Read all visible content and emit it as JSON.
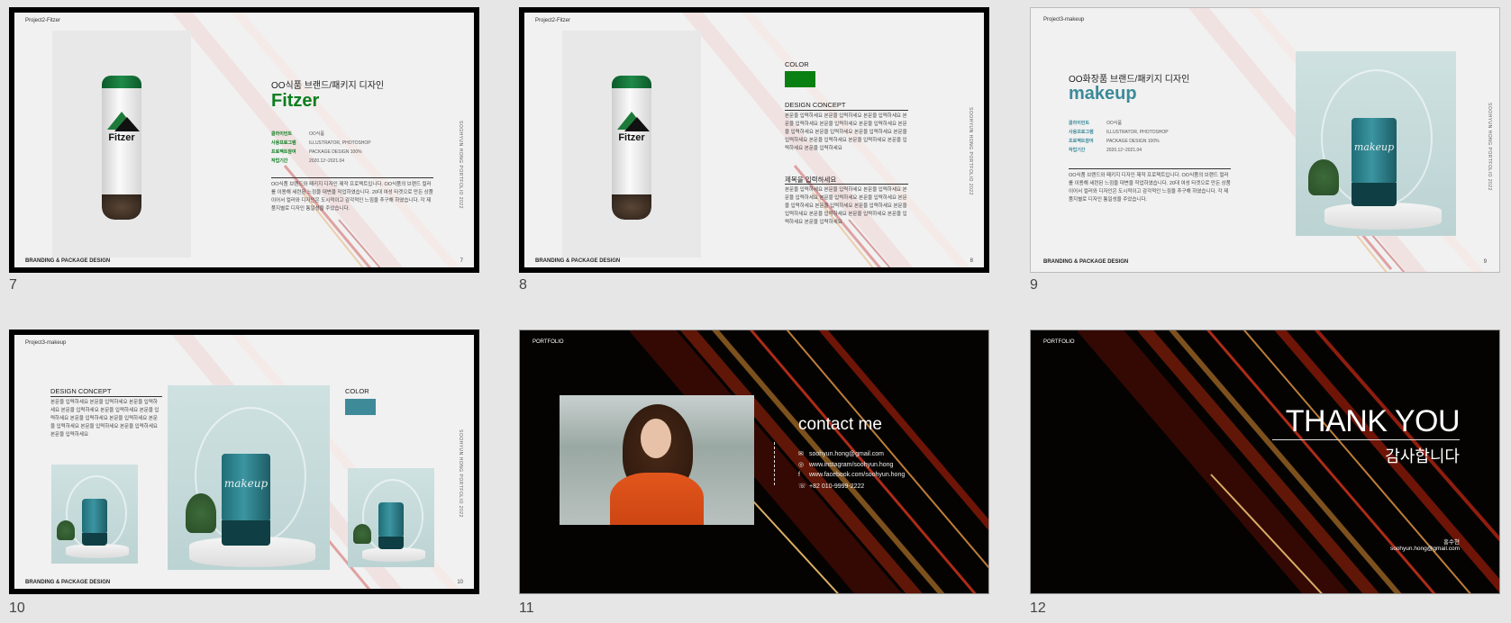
{
  "slides": [
    {
      "number": "7",
      "project_tag": "Project2-Fitzer",
      "footer_left": "BRANDING & PACKAGE DESIGN",
      "footer_right": "7",
      "vertical_text": "SOOHYUN HONG PORTFOLIO 2022",
      "kr_title": "OO식품 브랜드/패키지 디자인",
      "title": "Fitzer",
      "can_brand": "Fitzer",
      "info": [
        {
          "label": "클라이언트",
          "value": "OO식품"
        },
        {
          "label": "사용프로그램",
          "value": "ILLUSTRATOR, PHOTOSHOP"
        },
        {
          "label": "프로젝트참여",
          "value": "PACKAGE DESIGN 100%"
        },
        {
          "label": "작업기간",
          "value": "2020.12~2021.04"
        }
      ],
      "paragraph": "OO식품 브랜드와 패키지 디자인 제작 프로젝트입니다. OO식품의 브랜드 컬러를 이용해 세련된 느낌을 대변을 작업하였습니다. 20대 여성 타겟으로 만든 상품이어서 컬러와 디자인은 도시적이고 감각적인 느낌을 추구해 하였습니다. 각 제품지별로 디자인 통일성을 주었습니다."
    },
    {
      "number": "8",
      "project_tag": "Project2-Fitzer",
      "footer_left": "BRANDING & PACKAGE DESIGN",
      "footer_right": "8",
      "vertical_text": "SOOHYUN HONG PORTFOLIO 2022",
      "can_brand": "Fitzer",
      "color_label": "COLOR",
      "design_concept_label": "DESIGN CONCEPT",
      "design_concept_text": "본문을 입력하세요 본문을 입력하세요 본문을 입력하세요 본문을 입력하세요 본문을 입력하세요 본문을 입력하세요 본문을 입력하세요 본문을 입력하세요 본문을 입력하세요 본문을 입력하세요 본문을 입력하세요 본문을 입력하세요 본문을 입력하세요 본문을 입력하세요",
      "section2_title": "제목을 입력하세요",
      "section2_text": "본문을 입력하세요 본문을 입력하세요 본문을 입력하세요 본문을 입력하세요 본문을 입력하세요 본문을 입력하세요 본문을 입력하세요 본문을 입력하세요 본문을 입력하세요 본문을 입력하세요 본문을 입력하세요 본문을 입력하세요 본문을 입력하세요 본문을 입력하세요"
    },
    {
      "number": "9",
      "project_tag": "Project3-makeup",
      "footer_left": "BRANDING & PACKAGE DESIGN",
      "footer_right": "9",
      "vertical_text": "SOOHYUN HONG PORTFOLIO 2022",
      "kr_title": "OO화장품 브랜드/패키지 디자인",
      "title": "makeup",
      "info": [
        {
          "label": "클라이언트",
          "value": "OO식품"
        },
        {
          "label": "사용프로그램",
          "value": "ILLUSTRATOR, PHOTOSHOP"
        },
        {
          "label": "프로젝트참여",
          "value": "PACKAGE DESIGN 100%"
        },
        {
          "label": "작업기간",
          "value": "2020.12~2021.04"
        }
      ],
      "paragraph": "OO식품 브랜드와 패키지 디자인 제작 프로젝트입니다. OO식품의 브랜드 컬러를 이용해 세련된 느낌을 대변을 작업하였습니다. 20대 여성 타겟으로 만든 상품이어서 컬러와 디자인은 도시적이고 감각적인 느낌을 추구해 하였습니다. 각 제품지별로 디자인 통일성을 주었습니다.",
      "product_script": "makeup"
    },
    {
      "number": "10",
      "project_tag": "Project3-makeup",
      "footer_left": "BRANDING & PACKAGE DESIGN",
      "footer_right": "10",
      "vertical_text": "SOOHYUN HONG PORTFOLIO 2022",
      "design_concept_label": "DESIGN CONCEPT",
      "design_concept_text": "본문을 입력하세요 본문을 입력하세요 본문을 입력하세요 본문을 입력하세요 본문을 입력하세요 본문을 입력하세요 본문을 입력하세요 본문을 입력하세요 본문을 입력하세요 본문을 입력하세요 본문을 입력하세요 본문을 입력하세요",
      "color_label": "COLOR",
      "product_script": "makeup"
    },
    {
      "number": "11",
      "portfolio_tag": "PORTFOLIO",
      "heading": "contact me",
      "contacts": [
        {
          "icon": "email-icon",
          "glyph": "✉",
          "text": "soohyun.hong@gmail.com"
        },
        {
          "icon": "instagram-icon",
          "glyph": "◎",
          "text": "www.instagram/soohyun.hong"
        },
        {
          "icon": "facebook-icon",
          "glyph": "f",
          "text": "www.facebook.com/soohyun.hong"
        },
        {
          "icon": "phone-icon",
          "glyph": "☏",
          "text": "+82 010-9999-2222"
        }
      ]
    },
    {
      "number": "12",
      "portfolio_tag": "PORTFOLIO",
      "heading": "THANK YOU",
      "subheading": "감사합니다",
      "name": "홍수현",
      "email": "soohyun.hong@gmail.com"
    }
  ],
  "colors": {
    "fitzer_green": "#0d7d1f",
    "makeup_teal": "#3b8a9a",
    "swatch_green": "#0a7f12",
    "swatch_teal": "#3f8a98",
    "canvas_bg": "#e6e6e6"
  }
}
